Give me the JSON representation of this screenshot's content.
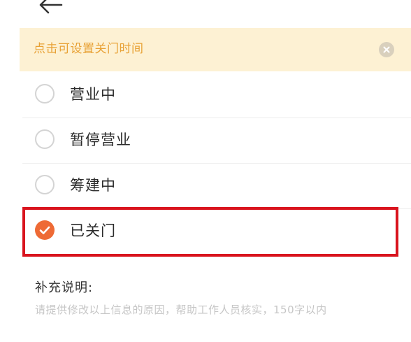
{
  "header": {
    "back_icon": "back-arrow-icon"
  },
  "notice": {
    "text": "点击可设置关门时间",
    "close_icon": "close-icon",
    "background_color": "#fdf1d3",
    "text_color": "#e8a135"
  },
  "status_options": {
    "items": [
      {
        "label": "营业中",
        "selected": false
      },
      {
        "label": "暂停营业",
        "selected": false
      },
      {
        "label": "筹建中",
        "selected": false
      },
      {
        "label": "已关门",
        "selected": true
      }
    ],
    "selected_color": "#ee6a35",
    "highlight_color": "#d9141e"
  },
  "supplement": {
    "label": "补充说明:",
    "placeholder": "请提供修改以上信息的原因，帮助工作人员核实，150字以内"
  }
}
